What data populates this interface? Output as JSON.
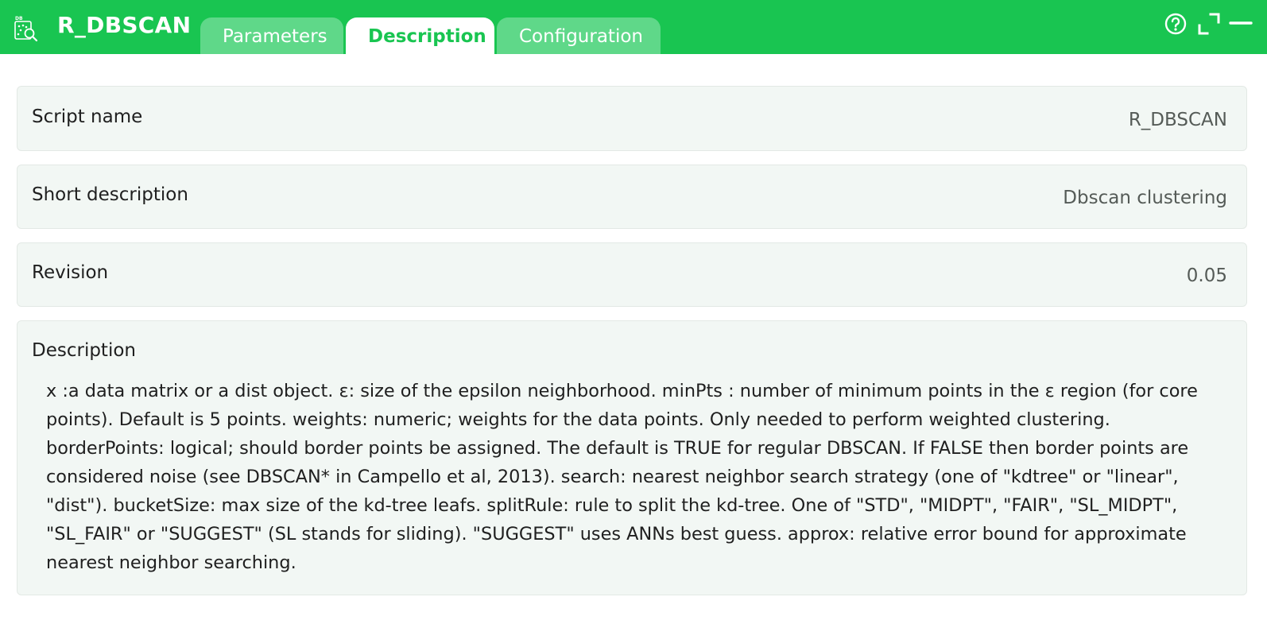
{
  "app": {
    "title": "R_DBSCAN",
    "icon": "dbscan-search-icon"
  },
  "tabs": [
    {
      "label": "Parameters",
      "active": false
    },
    {
      "label": "Description",
      "active": true
    },
    {
      "label": "Configuration",
      "active": false
    }
  ],
  "header_controls": [
    "help-icon",
    "maximize-icon",
    "minimize-icon"
  ],
  "fields": {
    "script_name": {
      "label": "Script name",
      "value": "R_DBSCAN"
    },
    "short_description": {
      "label": "Short description",
      "value": "Dbscan clustering"
    },
    "revision": {
      "label": "Revision",
      "value": "0.05"
    },
    "description": {
      "label": "Description",
      "value": "x :a data matrix or a dist object. ε: size of the epsilon neighborhood. minPts : number of minimum points in the ε region (for core points). Default is 5 points. weights: numeric; weights for the data points. Only needed to perform weighted clustering. borderPoints: logical; should border points be assigned. The default is TRUE for regular DBSCAN. If FALSE then border points are considered noise (see DBSCAN* in Campello et al, 2013). search: nearest neighbor search strategy (one of \"kdtree\" or \"linear\", \"dist\"). bucketSize: max size of the kd-tree leafs. splitRule: rule to split the kd-tree. One of \"STD\", \"MIDPT\", \"FAIR\", \"SL_MIDPT\", \"SL_FAIR\" or \"SUGGEST\" (SL stands for sliding). \"SUGGEST\" uses ANNs best guess. approx: relative error bound for approximate nearest neighbor searching."
    }
  },
  "colors": {
    "header": "#19c551",
    "tab_inactive": "#5fd889",
    "card_bg": "#f2f7f4"
  }
}
